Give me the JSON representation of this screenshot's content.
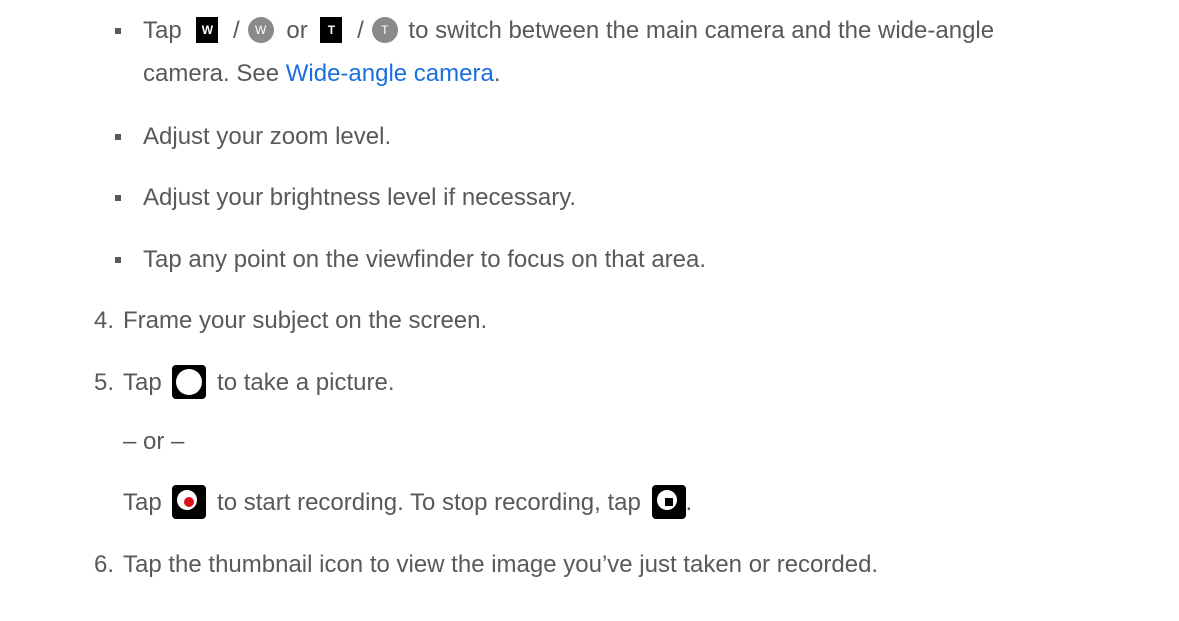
{
  "bullets": [
    {
      "part1": "Tap",
      "icon_w_sq": "W",
      "slash1": "/",
      "icon_w_circ": "W",
      "or": "or",
      "icon_t_sq": "T",
      "slash2": "/",
      "icon_t_circ": "T",
      "part2": "to switch between the main camera and the wide-angle",
      "line2_prefix": "camera. See ",
      "link": "Wide-angle camera",
      "line2_suffix": "."
    },
    {
      "text": "Adjust your zoom level."
    },
    {
      "text": "Adjust your brightness level if necessary."
    },
    {
      "text": "Tap any point on the viewfinder to focus on that area."
    }
  ],
  "steps": [
    {
      "num": "4.",
      "text": "Frame your subject on the screen."
    },
    {
      "num": "5.",
      "prefix": "Tap",
      "suffix": "to take a picture.",
      "or_line": "– or –",
      "rec_prefix": "Tap",
      "rec_mid": "to start recording. To stop recording, tap",
      "rec_suffix": "."
    },
    {
      "num": "6.",
      "text": "Tap the thumbnail icon to view the image you’ve just taken or recorded."
    }
  ],
  "icons": {
    "shutter": "shutter-icon",
    "record": "record-icon",
    "stop": "stop-icon"
  },
  "colors": {
    "text": "#595959",
    "link": "#1a6fe0",
    "record_dot": "#e0101a"
  }
}
